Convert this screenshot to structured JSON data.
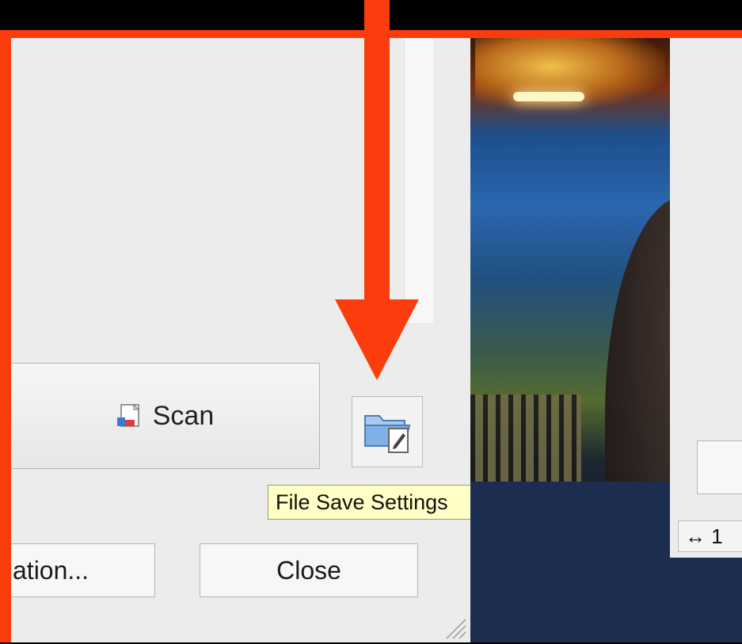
{
  "scan_button": {
    "label": "Scan",
    "icon": "scan-document-icon"
  },
  "file_save_settings": {
    "icon": "folder-settings-icon",
    "tooltip": "File Save Settings"
  },
  "calibration_button": {
    "label": "ation..."
  },
  "close_button": {
    "label": "Close"
  },
  "right_panel": {
    "dimension_label": "1",
    "dimension_icon": "width-arrows-icon"
  },
  "annotation": {
    "arrow_color": "#fb3d0d",
    "frame_color": "#fb3d0d"
  }
}
